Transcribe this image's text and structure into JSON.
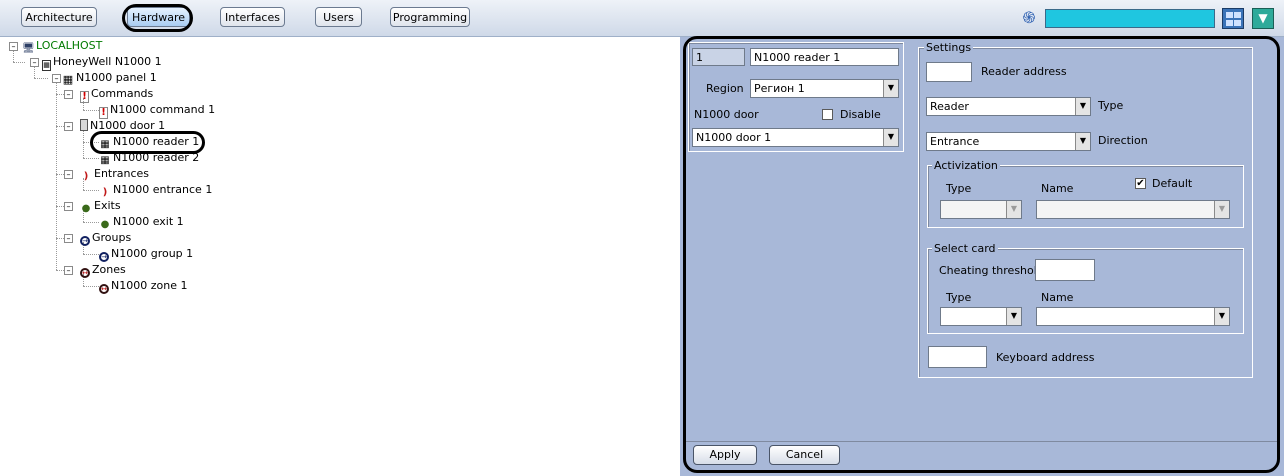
{
  "toolbar": {
    "tabs": [
      "Architecture",
      "Hardware",
      "Interfaces",
      "Users",
      "Programming"
    ],
    "active_tab": "Hardware"
  },
  "tree": {
    "nodes": [
      "LOCALHOST",
      "HoneyWell N1000 1",
      "N1000 panel 1",
      "Commands",
      "N1000 command 1",
      "N1000 door 1",
      "N1000 reader 1",
      "N1000 reader 2",
      "Entrances",
      "N1000 entrance 1",
      "Exits",
      "N1000 exit 1",
      "Groups",
      "N1000 group 1",
      "Zones",
      "N1000 zone 1"
    ],
    "selected": "N1000 reader 1"
  },
  "object": {
    "id": "1",
    "name": "N1000 reader 1",
    "region_label": "Region",
    "region_value": "Регион 1",
    "door_label": "N1000 door",
    "disable_label": "Disable",
    "door_value": "N1000 door 1"
  },
  "settings": {
    "title": "Settings",
    "reader_address_label": "Reader address",
    "reader_address_value": "",
    "type_value": "Reader",
    "type_label": "Type",
    "direction_value": "Entrance",
    "direction_label": "Direction",
    "activization": {
      "title": "Activization",
      "type_label": "Type",
      "name_label": "Name",
      "default_label": "Default",
      "default_checked": true
    },
    "select_card": {
      "title": "Select card",
      "cheating_label": "Cheating threshold",
      "type_label": "Type",
      "name_label": "Name"
    },
    "keyboard_label": "Keyboard address"
  },
  "buttons": {
    "apply": "Apply",
    "cancel": "Cancel"
  },
  "colors": {
    "panel_bg": "#a8b8d8",
    "status_bar": "#1fc6e0",
    "localhost_text": "#007a00"
  }
}
